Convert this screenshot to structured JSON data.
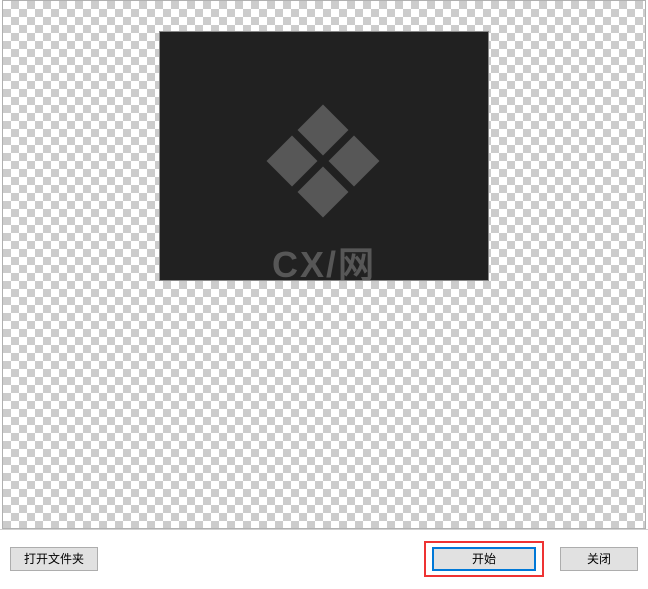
{
  "canvas": {
    "watermark_text": "CX/网"
  },
  "buttons": {
    "open_folder": "打开文件夹",
    "start": "开始",
    "close": "关闭"
  }
}
